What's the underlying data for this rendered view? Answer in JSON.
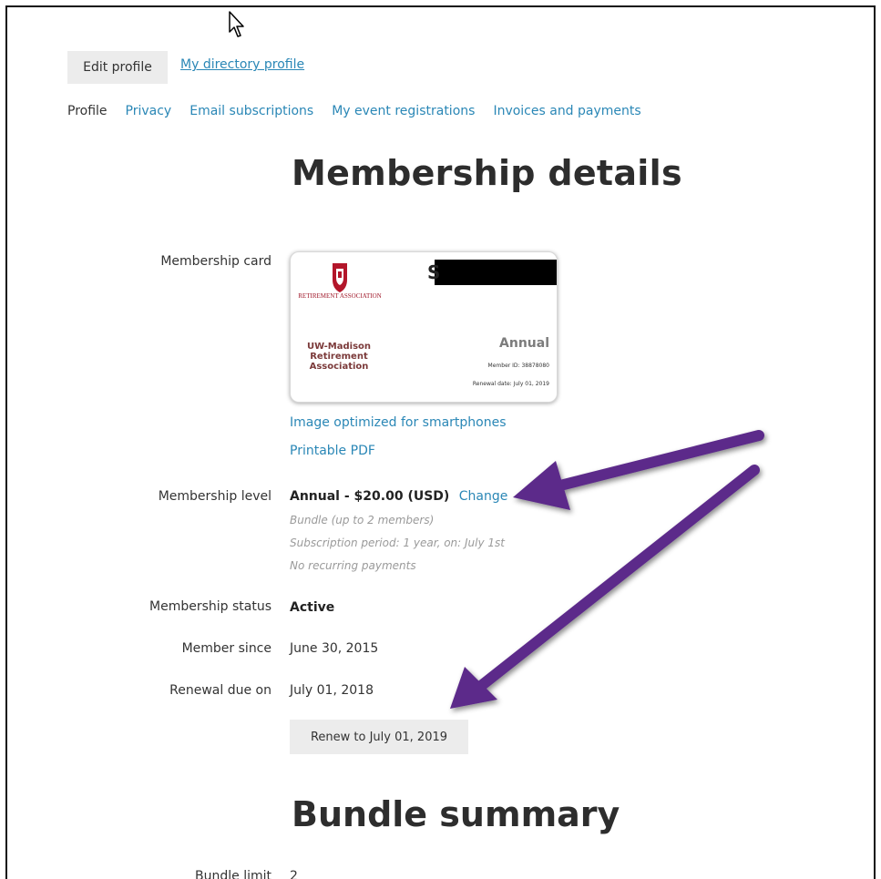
{
  "top_nav": {
    "edit_profile_label": "Edit profile",
    "directory_link": "My directory profile"
  },
  "tabs": [
    {
      "label": "Profile",
      "active": true
    },
    {
      "label": "Privacy",
      "active": false
    },
    {
      "label": "Email subscriptions",
      "active": false
    },
    {
      "label": "My event registrations",
      "active": false
    },
    {
      "label": "Invoices and payments",
      "active": false
    }
  ],
  "section_title": "Membership details",
  "card": {
    "label": "Membership card",
    "logo_text": "RETIREMENT ASSOCIATION",
    "name_initial": "S",
    "org_name": "UW-Madison Retirement Association",
    "level": "Annual",
    "member_id": "Member ID: 38878080",
    "renewal_date": "Renewal date: July 01, 2019",
    "smartphone_link": "Image optimized for smartphones",
    "pdf_link": "Printable PDF"
  },
  "membership_level": {
    "label": "Membership level",
    "value": "Annual - $20.00 (USD)",
    "change_link": "Change",
    "details": [
      "Bundle (up to 2 members)",
      "Subscription period: 1 year, on: July 1st",
      "No recurring payments"
    ]
  },
  "membership_status": {
    "label": "Membership status",
    "value": "Active"
  },
  "member_since": {
    "label": "Member since",
    "value": "June 30, 2015"
  },
  "renewal_due": {
    "label": "Renewal due on",
    "value": "July 01, 2018"
  },
  "renew_button_label": "Renew to July 01, 2019",
  "bundle_title": "Bundle summary",
  "bundle_limit": {
    "label": "Bundle limit",
    "value": "2"
  },
  "colors": {
    "link": "#2a87b6",
    "arrow": "#5b2a8a",
    "button_bg": "#ececec"
  },
  "icons": [
    "mouse-cursor-icon",
    "arrow-annotation-icon"
  ]
}
